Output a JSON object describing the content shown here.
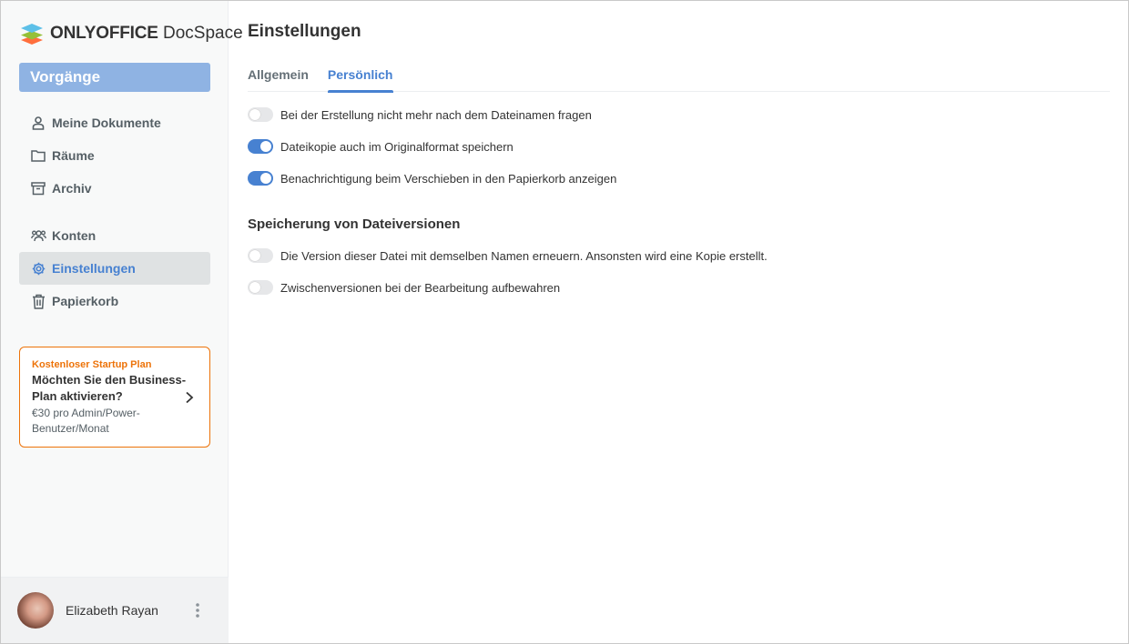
{
  "app": {
    "logo_brand": "ONLYOFFICE",
    "logo_product": "DocSpace"
  },
  "sidebar": {
    "action_button": "Vorgänge",
    "group1": [
      {
        "label": "Meine Dokumente",
        "icon": "person-icon"
      },
      {
        "label": "Räume",
        "icon": "folder-icon"
      },
      {
        "label": "Archiv",
        "icon": "archive-icon"
      }
    ],
    "group2": [
      {
        "label": "Konten",
        "icon": "users-icon"
      },
      {
        "label": "Einstellungen",
        "icon": "gear-icon",
        "active": true
      },
      {
        "label": "Papierkorb",
        "icon": "trash-icon"
      }
    ],
    "promo": {
      "title": "Kostenloser Startup Plan",
      "headline": "Möchten Sie den Business-Plan aktivieren?",
      "subtext": "€30 pro Admin/Power-Benutzer/Monat"
    },
    "profile": {
      "name": "Elizabeth Rayan"
    }
  },
  "main": {
    "title": "Einstellungen",
    "tabs": [
      {
        "label": "Allgemein",
        "active": false
      },
      {
        "label": "Persönlich",
        "active": true
      }
    ],
    "toggles": [
      {
        "label": "Bei der Erstellung nicht mehr nach dem Dateinamen fragen",
        "on": false
      },
      {
        "label": "Dateikopie auch im Originalformat speichern",
        "on": true
      },
      {
        "label": "Benachrichtigung beim Verschieben in den Papierkorb anzeigen",
        "on": true
      }
    ],
    "versions_section": {
      "title": "Speicherung von Dateiversionen",
      "toggles": [
        {
          "label": "Die Version dieser Datei mit demselben Namen erneuern. Ansonsten wird eine Kopie erstellt.",
          "on": false
        },
        {
          "label": "Zwischenversionen bei der Bearbeitung aufbewahren",
          "on": false
        }
      ]
    }
  },
  "colors": {
    "accent": "#4781d1",
    "action_button": "#8fb3e3",
    "promo_border": "#ed7309"
  }
}
